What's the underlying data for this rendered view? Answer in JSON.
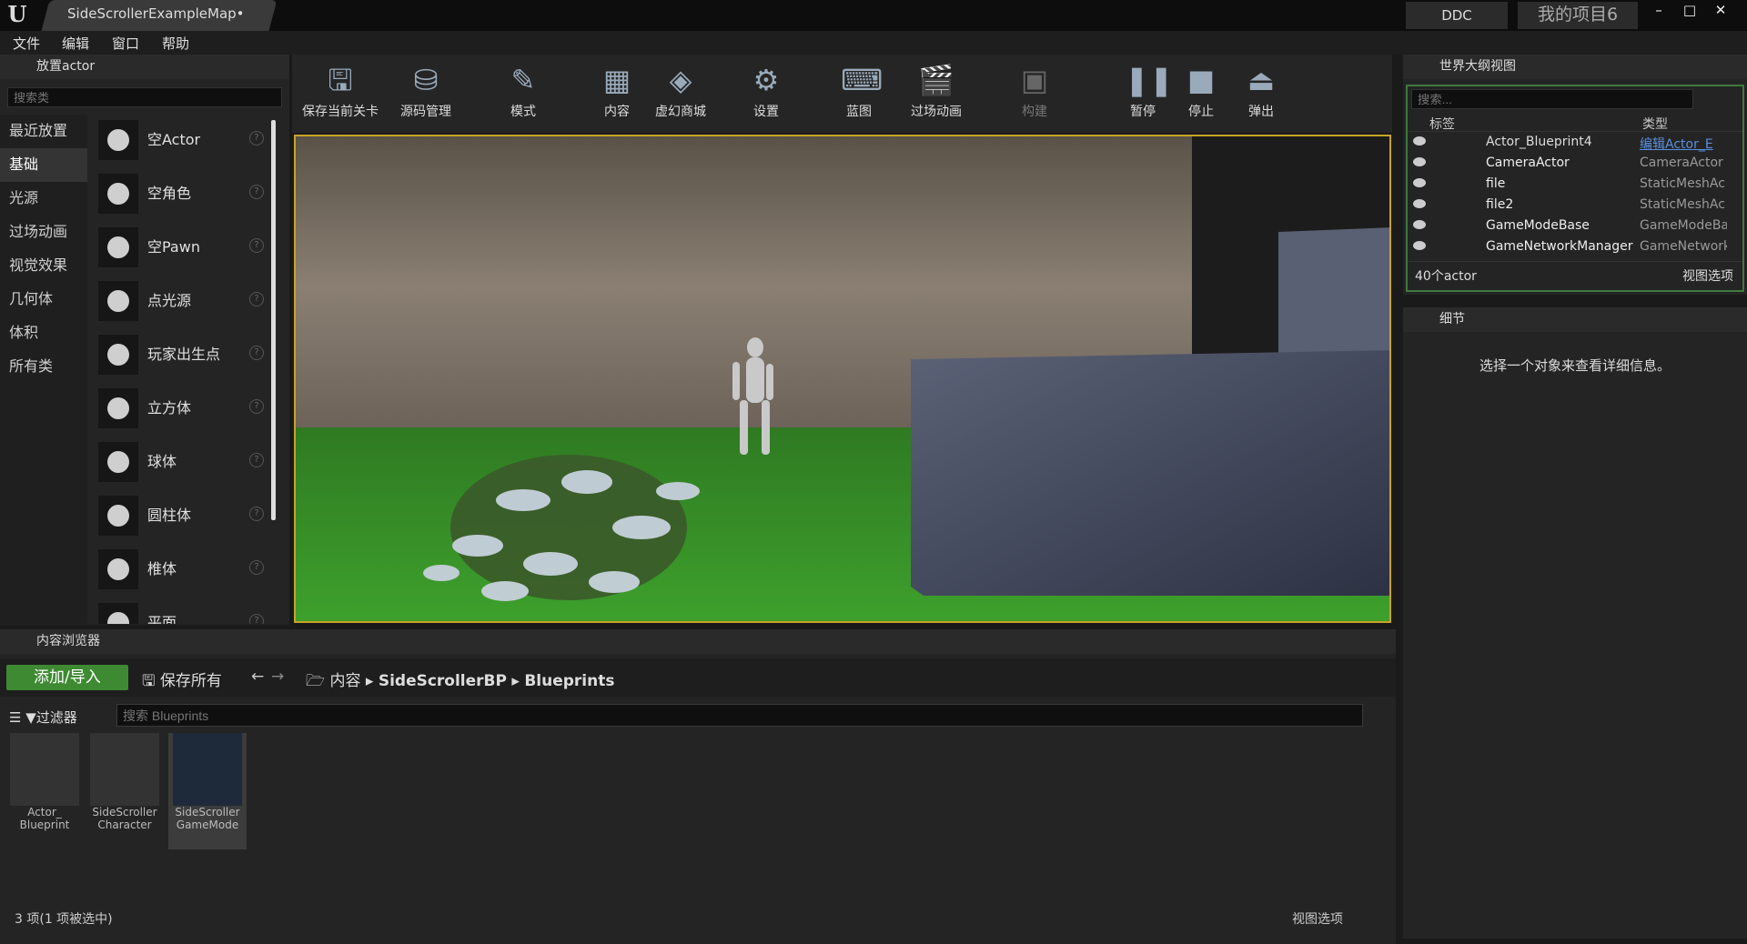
{
  "window": {
    "tab": "SideScrollerExampleMap•",
    "ddc": "DDC",
    "project": "我的项目6"
  },
  "menu": [
    "文件",
    "编辑",
    "窗口",
    "帮助"
  ],
  "place": {
    "tab": "放置actor",
    "search_placeholder": "搜索类",
    "categories": [
      "最近放置",
      "基础",
      "光源",
      "过场动画",
      "视觉效果",
      "几何体",
      "体积",
      "所有类"
    ],
    "items": [
      "空Actor",
      "空角色",
      "空Pawn",
      "点光源",
      "玩家出生点",
      "立方体",
      "球体",
      "圆柱体",
      "椎体",
      "平面"
    ]
  },
  "toolbar": [
    "保存当前关卡",
    "源码管理",
    "模式",
    "内容",
    "虚幻商城",
    "设置",
    "蓝图",
    "过场动画",
    "构建",
    "暂停",
    "停止",
    "弹出"
  ],
  "outliner": {
    "tab": "世界大纲视图",
    "search_placeholder": "搜索...",
    "col_label": "标签",
    "col_type": "类型",
    "rows": [
      {
        "name": "Actor_Blueprint4",
        "type": "编辑Actor_E"
      },
      {
        "name": "CameraActor",
        "type": "CameraActor"
      },
      {
        "name": "file",
        "type": "StaticMeshAc"
      },
      {
        "name": "file2",
        "type": "StaticMeshAc"
      },
      {
        "name": "GameModeBase",
        "type": "GameModeBa"
      },
      {
        "name": "GameNetworkManager",
        "type": "GameNetwork"
      }
    ],
    "count": "40个actor",
    "view_options": "视图选项"
  },
  "details": {
    "tab": "细节",
    "empty": "选择一个对象来查看详细信息。"
  },
  "content": {
    "tab": "内容浏览器",
    "add": "添加/导入",
    "save_all": "保存所有",
    "path": [
      "内容",
      "SideScrollerBP",
      "Blueprints"
    ],
    "filter": "过滤器",
    "search_placeholder": "搜索 Blueprints",
    "assets": [
      {
        "line1": "Actor_",
        "line2": "Blueprint"
      },
      {
        "line1": "SideScroller",
        "line2": "Character"
      },
      {
        "line1": "SideScroller",
        "line2": "GameMode"
      }
    ],
    "status": "3 项(1 项被选中)",
    "view_options": "视图选项"
  }
}
